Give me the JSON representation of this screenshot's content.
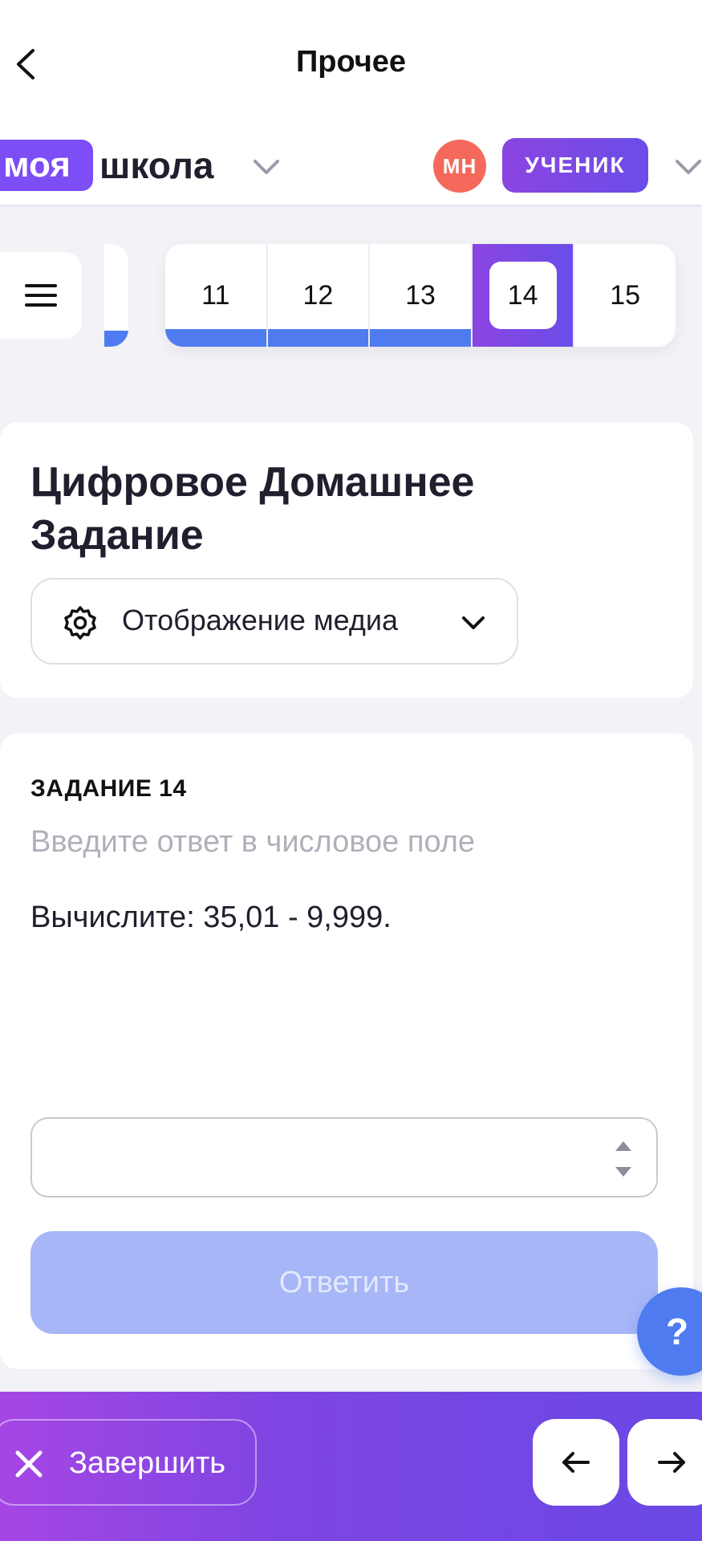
{
  "topbar": {
    "title": "Прочее",
    "back_icon": "chevron-left-icon"
  },
  "school_header": {
    "logo_part1": "моя",
    "logo_part2": "школа",
    "avatar_initials": "МН",
    "role": "УЧЕНИК",
    "colors": {
      "logo": "#7d4df5",
      "avatar": "#f4695b",
      "role_badge": "#8b45e0"
    }
  },
  "task_nav": {
    "menu_icon": "hamburger-menu-icon",
    "items": [
      {
        "label": "11",
        "state": "answered"
      },
      {
        "label": "12",
        "state": "answered"
      },
      {
        "label": "13",
        "state": "answered"
      },
      {
        "label": "14",
        "state": "current"
      },
      {
        "label": "15",
        "state": "unanswered"
      }
    ],
    "answered_color": "#4e7cf0"
  },
  "header_card": {
    "title": "Цифровое Домашнее Задание",
    "media_button_label": "Отображение медиа",
    "media_icon": "gear-icon"
  },
  "task": {
    "number_label": "ЗАДАНИЕ 14",
    "hint": "Введите ответ в числовое поле",
    "question": "Вычислите: 35,01 - 9,999.",
    "answer_value": "",
    "answer_placeholder": "",
    "submit_label": "Ответить"
  },
  "help": {
    "label": "?"
  },
  "bottombar": {
    "finish_label": "Завершить",
    "finish_icon": "close-icon",
    "prev_icon": "arrow-left-icon",
    "next_icon": "arrow-right-icon"
  }
}
